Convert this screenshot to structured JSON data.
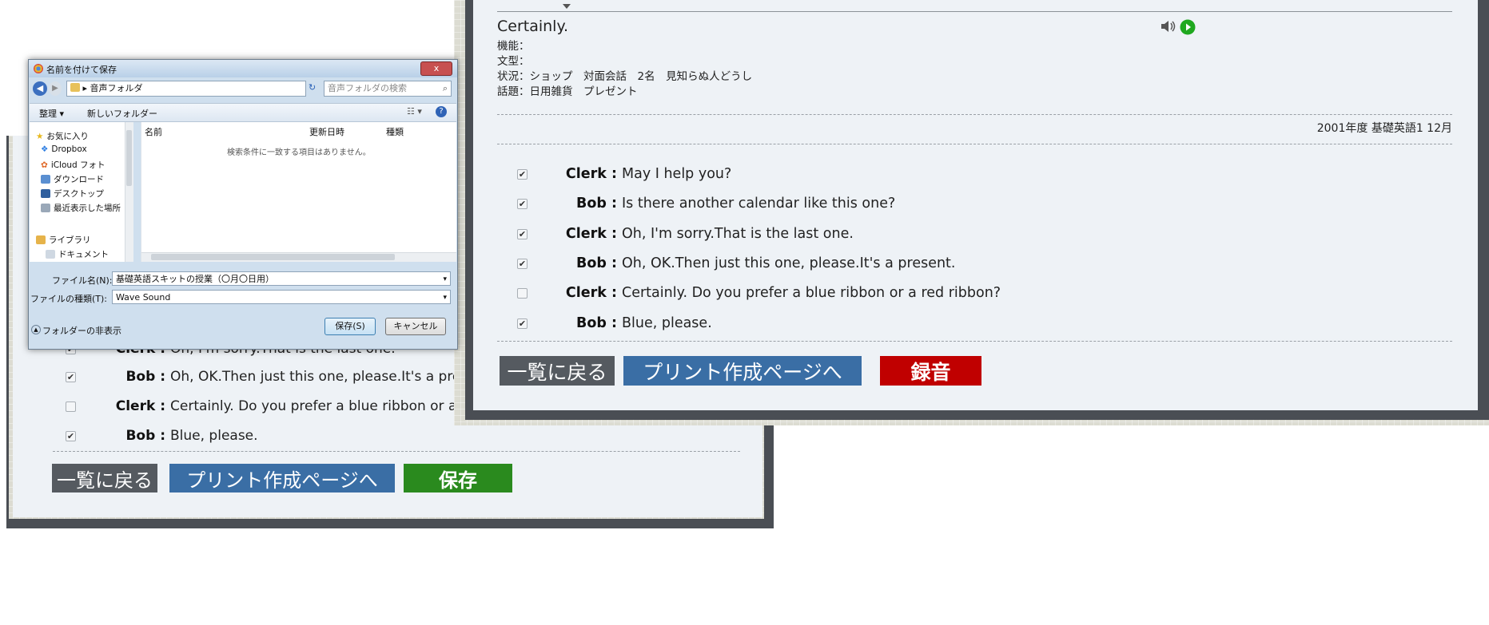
{
  "back_window": {
    "rows": [
      {
        "speaker": "Clerk :",
        "text": "Oh, I'm sorry.That is the last one.",
        "checked": true
      },
      {
        "speaker": "Bob :",
        "text": "Oh, OK.Then just this one, please.It's a pres",
        "checked": true
      },
      {
        "speaker": "Clerk :",
        "text": "Certainly. Do you prefer a blue ribbon or a r",
        "checked": false
      },
      {
        "speaker": "Bob :",
        "text": "Blue, please.",
        "checked": true
      }
    ],
    "buttons": {
      "back": "一覧に戻る",
      "print": "プリント作成ページへ",
      "save": "保存"
    }
  },
  "front_window": {
    "heading": "Certainly.",
    "meta": {
      "function": "機能：",
      "pattern": "文型：",
      "situation": "状況：ショップ　対面会話　2名　見知らぬ人どうし",
      "topic": "話題：日用雑貨　プレゼント"
    },
    "source": "2001年度 基礎英語1 12月",
    "rows": [
      {
        "speaker": "Clerk :",
        "text": "May I help you?",
        "checked": true
      },
      {
        "speaker": "Bob :",
        "text": "Is there another calendar like this one?",
        "checked": true
      },
      {
        "speaker": "Clerk :",
        "text": "Oh, I'm sorry.That is the last one.",
        "checked": true
      },
      {
        "speaker": "Bob :",
        "text": "Oh, OK.Then just this one, please.It's a present.",
        "checked": true
      },
      {
        "speaker": "Clerk :",
        "text": "Certainly. Do you prefer a blue ribbon or a red ribbon?",
        "checked": false
      },
      {
        "speaker": "Bob :",
        "text": "Blue, please.",
        "checked": true
      }
    ],
    "buttons": {
      "back": "一覧に戻る",
      "print": "プリント作成ページへ",
      "record": "録音"
    }
  },
  "dialog": {
    "title": "名前を付けて保存",
    "path": "音声フォルダ",
    "search_placeholder": "音声フォルダの検索",
    "toolbar": {
      "organize": "整理 ▾",
      "new_folder": "新しいフォルダー"
    },
    "nav_items": [
      "お気に入り",
      "Dropbox",
      "iCloud フォト",
      "ダウンロード",
      "デスクトップ",
      "最近表示した場所",
      "ライブラリ",
      "ドキュメント"
    ],
    "columns": {
      "name": "名前",
      "modified": "更新日時",
      "type": "種類"
    },
    "empty_message": "検索条件に一致する項目はありません。",
    "filename_label": "ファイル名(N):",
    "filename_value": "基礎英語スキットの授業（〇月〇日用）",
    "filetype_label": "ファイルの種類(T):",
    "filetype_value": "Wave Sound",
    "hide_folders": "フォルダーの非表示",
    "save_button": "保存(S)",
    "cancel_button": "キャンセル",
    "close_button": "x"
  },
  "colors": {
    "blue_button": "#3a6ea5",
    "gray_button": "#555a60",
    "green_button": "#2a8a1e",
    "red_button": "#c00000",
    "play_icon": "#1fa81f"
  }
}
